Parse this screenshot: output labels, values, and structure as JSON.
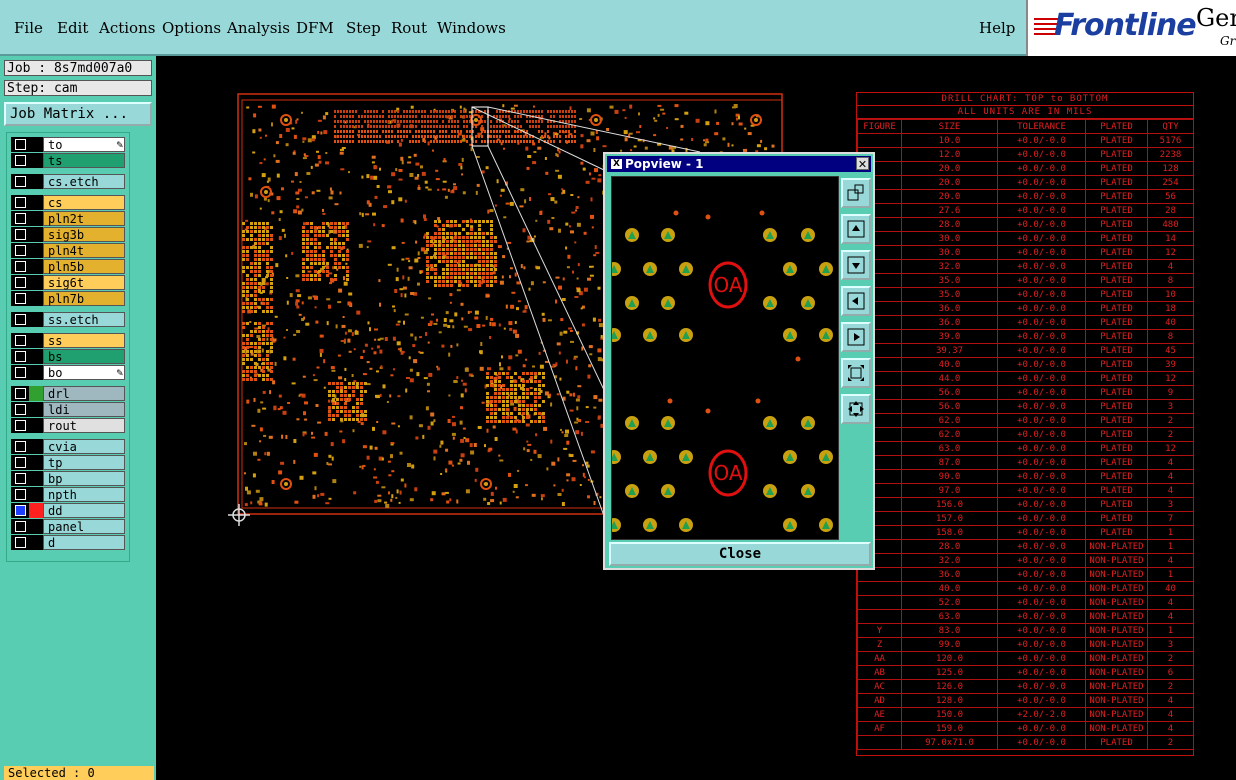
{
  "menu": {
    "file": "File",
    "edit": "Edit",
    "actions": "Actions",
    "options": "Options",
    "analysis": "Analysis",
    "dfm": "DFM",
    "step": "Step",
    "rout": "Rout",
    "windows": "Windows",
    "help": "Help"
  },
  "logo": {
    "word": "Frontline",
    "gen": "Gen",
    "gr": "Gr"
  },
  "job": {
    "label": "Job : 8s7md007a0",
    "step": "Step: cam",
    "matrix_button": "Job Matrix ..."
  },
  "layers": [
    {
      "name": "to",
      "color": "#ffffff",
      "edit": true,
      "group": 0
    },
    {
      "name": "ts",
      "color": "#20a070",
      "edit": false,
      "group": 0
    },
    {
      "name": "cs.etch",
      "color": "#99d8d8",
      "edit": false,
      "group": 1
    },
    {
      "name": "cs",
      "color": "#ffcd5a",
      "edit": false,
      "group": 2
    },
    {
      "name": "pln2t",
      "color": "#e3b12d",
      "edit": false,
      "group": 2
    },
    {
      "name": "sig3b",
      "color": "#e3b12d",
      "edit": false,
      "group": 2
    },
    {
      "name": "pln4t",
      "color": "#e3b12d",
      "edit": false,
      "group": 2
    },
    {
      "name": "pln5b",
      "color": "#e3b12d",
      "edit": false,
      "group": 2
    },
    {
      "name": "sig6t",
      "color": "#ffcd5a",
      "edit": false,
      "group": 2
    },
    {
      "name": "pln7b",
      "color": "#e3b12d",
      "edit": false,
      "group": 2
    },
    {
      "name": "ss.etch",
      "color": "#99d8d8",
      "edit": false,
      "group": 3
    },
    {
      "name": "ss",
      "color": "#ffcd5a",
      "edit": false,
      "group": 4
    },
    {
      "name": "bs",
      "color": "#20a070",
      "edit": false,
      "group": 4
    },
    {
      "name": "bo",
      "color": "#ffffff",
      "edit": true,
      "group": 4
    },
    {
      "name": "drl",
      "color": "#9fb8c0",
      "edit": false,
      "group": 5
    },
    {
      "name": "ldi",
      "color": "#9fb8c0",
      "edit": false,
      "group": 5
    },
    {
      "name": "rout",
      "color": "#e0e0e0",
      "edit": false,
      "group": 5
    },
    {
      "name": "cvia",
      "color": "#99d8d8",
      "edit": false,
      "group": 6
    },
    {
      "name": "tp",
      "color": "#99d8d8",
      "edit": false,
      "group": 6
    },
    {
      "name": "bp",
      "color": "#99d8d8",
      "edit": false,
      "group": 6
    },
    {
      "name": "npth",
      "color": "#99d8d8",
      "edit": false,
      "group": 6
    },
    {
      "name": "dd",
      "color": "#99d8d8",
      "edit": false,
      "group": 6
    },
    {
      "name": "panel",
      "color": "#99d8d8",
      "edit": false,
      "group": 6
    },
    {
      "name": "d",
      "color": "#99d8d8",
      "edit": false,
      "group": 6
    }
  ],
  "status": {
    "selected": "Selected : 0"
  },
  "popview": {
    "title": "Popview - 1",
    "close_label": "Close",
    "pad_label": "OA"
  },
  "drill_chart": {
    "title1": "DRILL CHART: TOP to BOTTOM",
    "title2": "ALL UNITS ARE IN MILS",
    "headers": [
      "FIGURE",
      "SIZE",
      "TOLERANCE",
      "PLATED",
      "QTY"
    ],
    "rows": [
      [
        "",
        "10.0",
        "+0.0/-0.0",
        "PLATED",
        "5176"
      ],
      [
        "",
        "12.0",
        "+0.0/-0.0",
        "PLATED",
        "2238"
      ],
      [
        "",
        "20.0",
        "+0.0/-0.0",
        "PLATED",
        "128"
      ],
      [
        "",
        "20.0",
        "+0.0/-0.0",
        "PLATED",
        "254"
      ],
      [
        "",
        "20.0",
        "+0.0/-0.0",
        "PLATED",
        "56"
      ],
      [
        "",
        "27.6",
        "+0.0/-0.0",
        "PLATED",
        "28"
      ],
      [
        "",
        "28.0",
        "+0.0/-0.0",
        "PLATED",
        "480"
      ],
      [
        "",
        "30.0",
        "+0.0/-0.0",
        "PLATED",
        "14"
      ],
      [
        "",
        "30.0",
        "+0.0/-0.0",
        "PLATED",
        "12"
      ],
      [
        "",
        "32.0",
        "+0.0/-0.0",
        "PLATED",
        "4"
      ],
      [
        "",
        "35.0",
        "+0.0/-0.0",
        "PLATED",
        "8"
      ],
      [
        "",
        "35.0",
        "+0.0/-0.0",
        "PLATED",
        "10"
      ],
      [
        "",
        "36.0",
        "+0.0/-0.0",
        "PLATED",
        "18"
      ],
      [
        "",
        "36.0",
        "+0.0/-0.0",
        "PLATED",
        "40"
      ],
      [
        "",
        "39.0",
        "+0.0/-0.0",
        "PLATED",
        "8"
      ],
      [
        "",
        "39.37",
        "+0.0/-0.0",
        "PLATED",
        "45"
      ],
      [
        "",
        "40.0",
        "+0.0/-0.0",
        "PLATED",
        "39"
      ],
      [
        "",
        "44.0",
        "+0.0/-0.0",
        "PLATED",
        "12"
      ],
      [
        "",
        "56.0",
        "+0.0/-0.0",
        "PLATED",
        "9"
      ],
      [
        "",
        "56.0",
        "+0.0/-0.0",
        "PLATED",
        "3"
      ],
      [
        "",
        "62.0",
        "+0.0/-0.0",
        "PLATED",
        "2"
      ],
      [
        "",
        "62.0",
        "+0.0/-0.0",
        "PLATED",
        "2"
      ],
      [
        "",
        "63.0",
        "+0.0/-0.0",
        "PLATED",
        "12"
      ],
      [
        "",
        "87.0",
        "+0.0/-0.0",
        "PLATED",
        "4"
      ],
      [
        "",
        "90.0",
        "+0.0/-0.0",
        "PLATED",
        "4"
      ],
      [
        "",
        "97.0",
        "+0.0/-0.0",
        "PLATED",
        "4"
      ],
      [
        "",
        "156.0",
        "+0.0/-0.0",
        "PLATED",
        "3"
      ],
      [
        "",
        "157.0",
        "+0.0/-0.0",
        "PLATED",
        "7"
      ],
      [
        "",
        "158.0",
        "+0.0/-0.0",
        "PLATED",
        "1"
      ],
      [
        "",
        "28.0",
        "+0.0/-0.0",
        "NON-PLATED",
        "1"
      ],
      [
        "",
        "32.0",
        "+0.0/-0.0",
        "NON-PLATED",
        "4"
      ],
      [
        "",
        "36.0",
        "+0.0/-0.0",
        "NON-PLATED",
        "1"
      ],
      [
        "",
        "40.0",
        "+0.0/-0.0",
        "NON-PLATED",
        "40"
      ],
      [
        "",
        "52.0",
        "+0.0/-0.0",
        "NON-PLATED",
        "4"
      ],
      [
        "",
        "63.0",
        "+0.0/-0.0",
        "NON-PLATED",
        "4"
      ],
      [
        "Y",
        "83.0",
        "+0.0/-0.0",
        "NON-PLATED",
        "1"
      ],
      [
        "Z",
        "99.0",
        "+0.0/-0.0",
        "NON-PLATED",
        "3"
      ],
      [
        "AA",
        "120.0",
        "+0.0/-0.0",
        "NON-PLATED",
        "2"
      ],
      [
        "AB",
        "125.0",
        "+0.0/-0.0",
        "NON-PLATED",
        "6"
      ],
      [
        "AC",
        "126.0",
        "+0.0/-0.0",
        "NON-PLATED",
        "2"
      ],
      [
        "AD",
        "128.0",
        "+0.0/-0.0",
        "NON-PLATED",
        "4"
      ],
      [
        "AE",
        "150.0",
        "+2.0/-2.0",
        "NON-PLATED",
        "4"
      ],
      [
        "AF",
        "159.0",
        "+0.0/-0.0",
        "NON-PLATED",
        "4"
      ],
      [
        "",
        "97.0x71.0",
        "+0.0/-0.0",
        "PLATED",
        "2"
      ]
    ]
  },
  "colors": {
    "menu_bg": "#99d8d8",
    "panel_bg": "#59cdb1",
    "copper_red": "#e05010",
    "copper_gold": "#d4a010",
    "drill_red": "#e02020",
    "selected_bg": "#ffcd5a"
  }
}
